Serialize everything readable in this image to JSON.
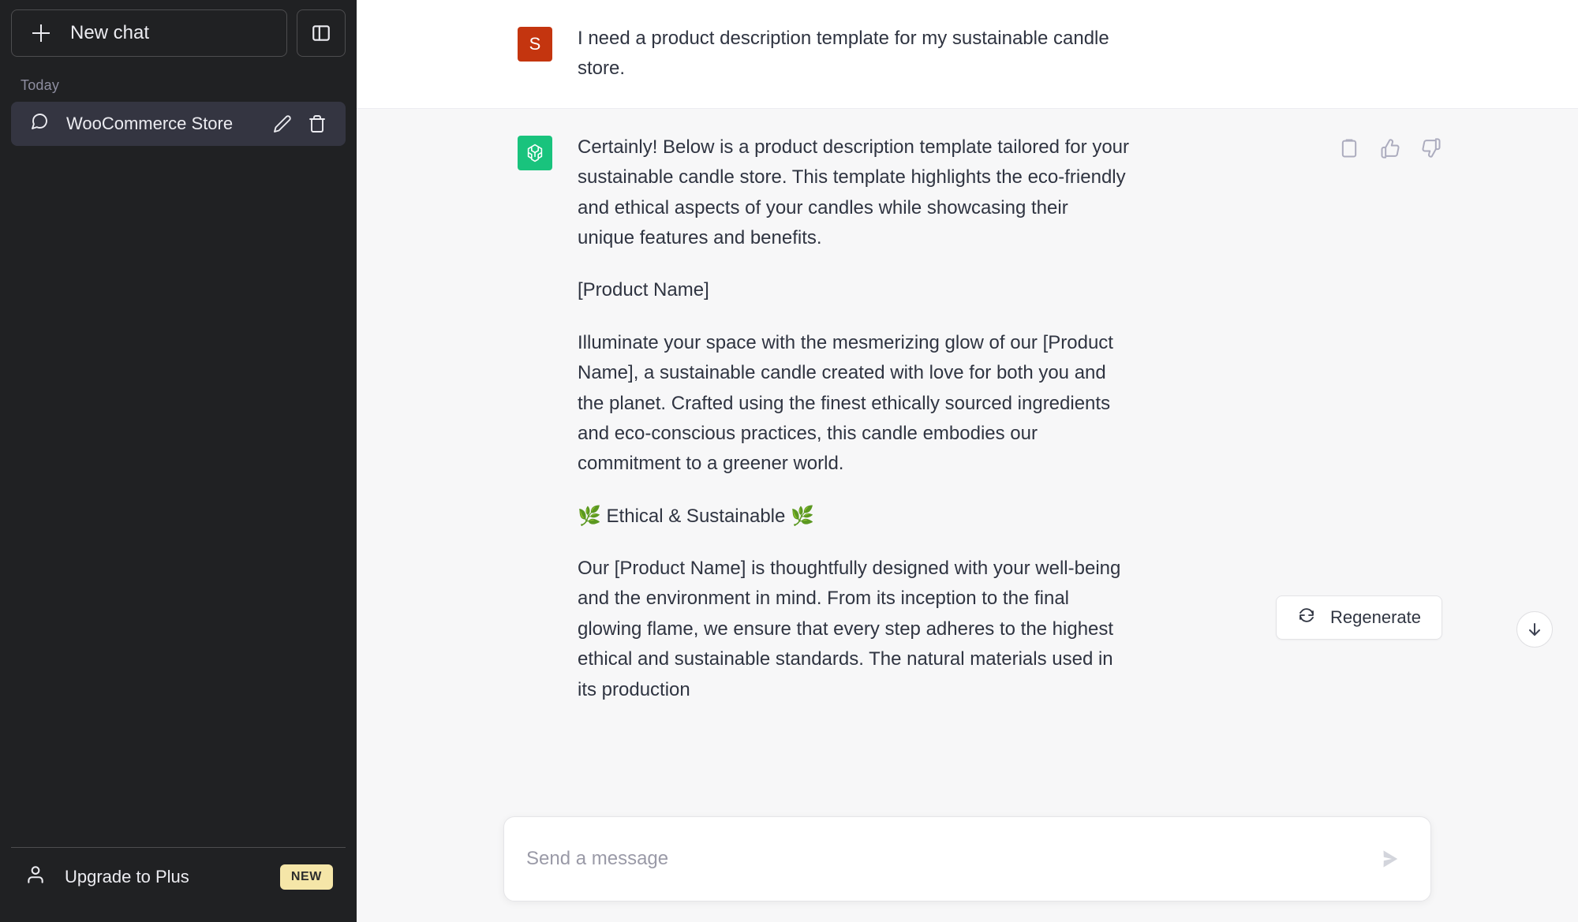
{
  "sidebar": {
    "new_chat_label": "New chat",
    "new_chat_icon": "plus-icon",
    "panel_toggle_icon": "sidebar-panel-icon",
    "section_label": "Today",
    "chats": [
      {
        "title": "WooCommerce Store",
        "icon": "chat-bubble-icon",
        "edit_icon": "pencil-icon",
        "delete_icon": "trash-icon",
        "selected": true
      }
    ],
    "footer": {
      "upgrade_label": "Upgrade to Plus",
      "upgrade_icon": "person-icon",
      "badge": "NEW"
    }
  },
  "thread": {
    "messages": [
      {
        "role": "user",
        "avatar_letter": "S",
        "avatar_color": "#c4350f",
        "paragraphs": [
          "I need a product description template for my sustainable candle store."
        ]
      },
      {
        "role": "assistant",
        "avatar_icon": "openai-logo-icon",
        "avatar_color": "#19c37d",
        "paragraphs": [
          "Certainly! Below is a product description template tailored for your sustainable candle store. This template highlights the eco-friendly and ethical aspects of your candles while showcasing their unique features and benefits.",
          "[Product Name]",
          "Illuminate your space with the mesmerizing glow of our [Product Name], a sustainable candle created with love for both you and the planet. Crafted using the finest ethically sourced ingredients and eco-conscious practices, this candle embodies our commitment to a greener world.",
          "🌿 Ethical & Sustainable 🌿",
          "Our [Product Name] is thoughtfully designed with your well-being and the environment in mind. From its inception to the final glowing flame, we ensure that every step adheres to the highest ethical and sustainable standards. The natural materials used in its production"
        ],
        "actions": [
          {
            "name": "copy-icon",
            "label": "Copy"
          },
          {
            "name": "thumbs-up-icon",
            "label": "Good response"
          },
          {
            "name": "thumbs-down-icon",
            "label": "Bad response"
          }
        ]
      }
    ]
  },
  "composer": {
    "placeholder": "Send a message",
    "value": "",
    "send_icon": "send-arrow-icon",
    "regenerate_label": "Regenerate",
    "regenerate_icon": "refresh-icon",
    "scroll_to_bottom_icon": "arrow-down-icon"
  },
  "colors": {
    "sidebar_bg": "#202123",
    "sidebar_selected": "#343541",
    "main_bg": "#f7f7f8",
    "user_msg_bg": "#ffffff",
    "accent_green": "#19c37d",
    "user_avatar": "#c4350f",
    "badge_yellow": "#f5e6a8",
    "text": "#2f3441"
  }
}
